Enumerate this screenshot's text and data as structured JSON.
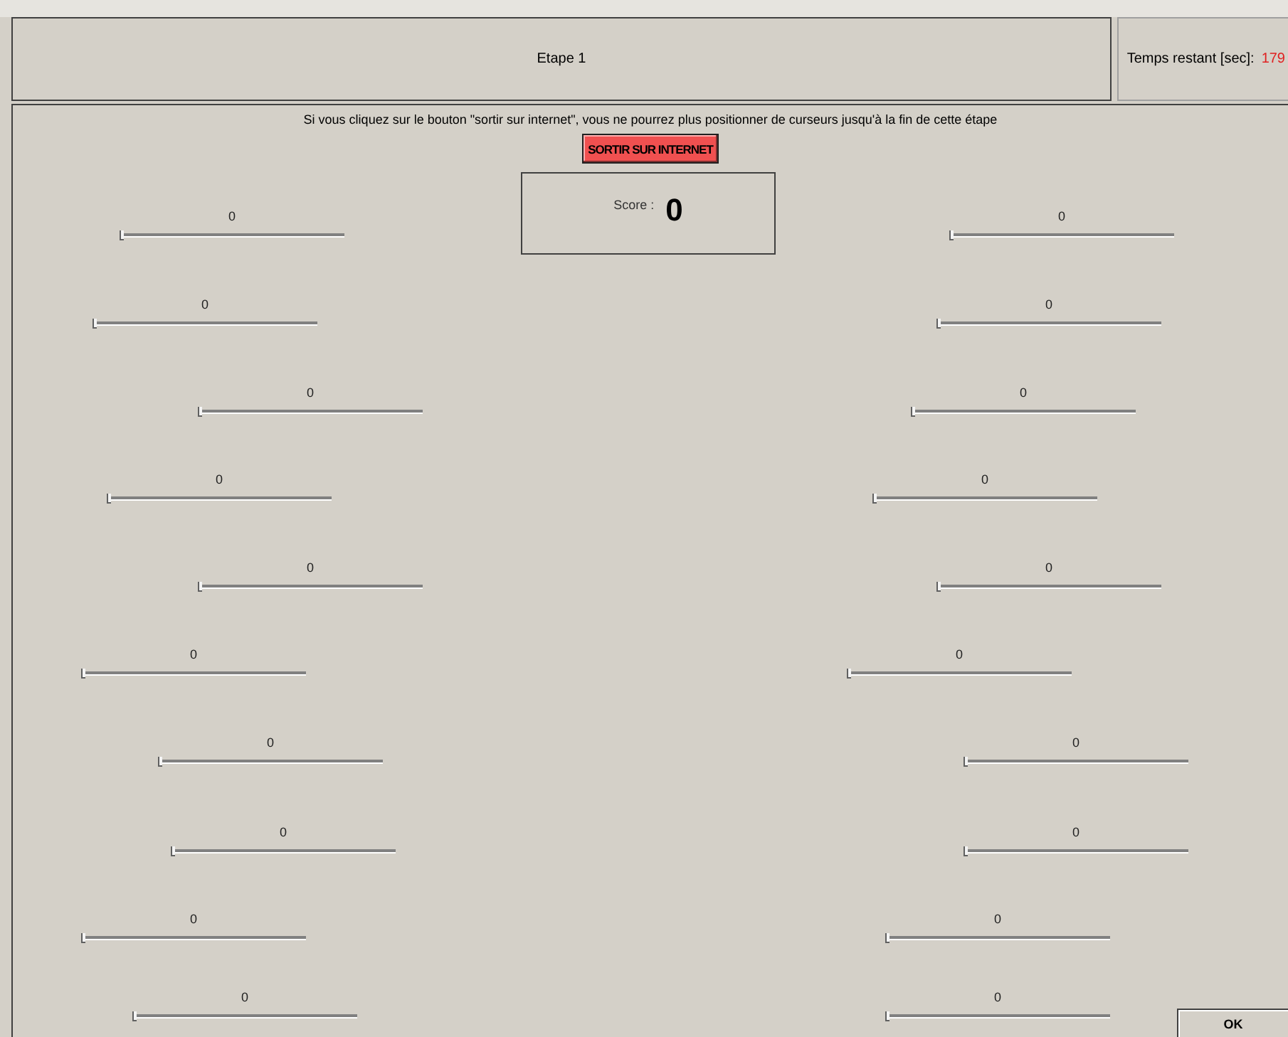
{
  "header": {
    "title": "Etape 1",
    "timer_label": "Temps restant [sec]:",
    "timer_value": "179"
  },
  "notice": "Si vous cliquez sur le bouton \"sortir sur internet\", vous ne pourrez plus positionner de curseurs jusqu'à la fin de cette étape",
  "exit_button": "SORTIR SUR INTERNET",
  "score": {
    "label": "Score :",
    "value": "0"
  },
  "sliders": [
    {
      "reading": "0",
      "level": 0
    },
    {
      "reading": "0",
      "level": 0
    },
    {
      "reading": "0",
      "level": 0
    },
    {
      "reading": "0",
      "level": 0
    },
    {
      "reading": "0",
      "level": 0
    },
    {
      "reading": "0",
      "level": 0
    },
    {
      "reading": "0",
      "level": 0
    },
    {
      "reading": "0",
      "level": 0
    },
    {
      "reading": "0",
      "level": 0
    },
    {
      "reading": "0",
      "level": 0
    },
    {
      "reading": "0",
      "level": 0
    },
    {
      "reading": "0",
      "level": 0
    },
    {
      "reading": "0",
      "level": 0
    },
    {
      "reading": "0",
      "level": 0
    },
    {
      "reading": "0",
      "level": 0
    },
    {
      "reading": "0",
      "level": 0
    },
    {
      "reading": "0",
      "level": 0
    },
    {
      "reading": "0",
      "level": 0
    },
    {
      "reading": "0",
      "level": 0
    },
    {
      "reading": "0",
      "level": 0
    }
  ],
  "ok_button": "OK"
}
